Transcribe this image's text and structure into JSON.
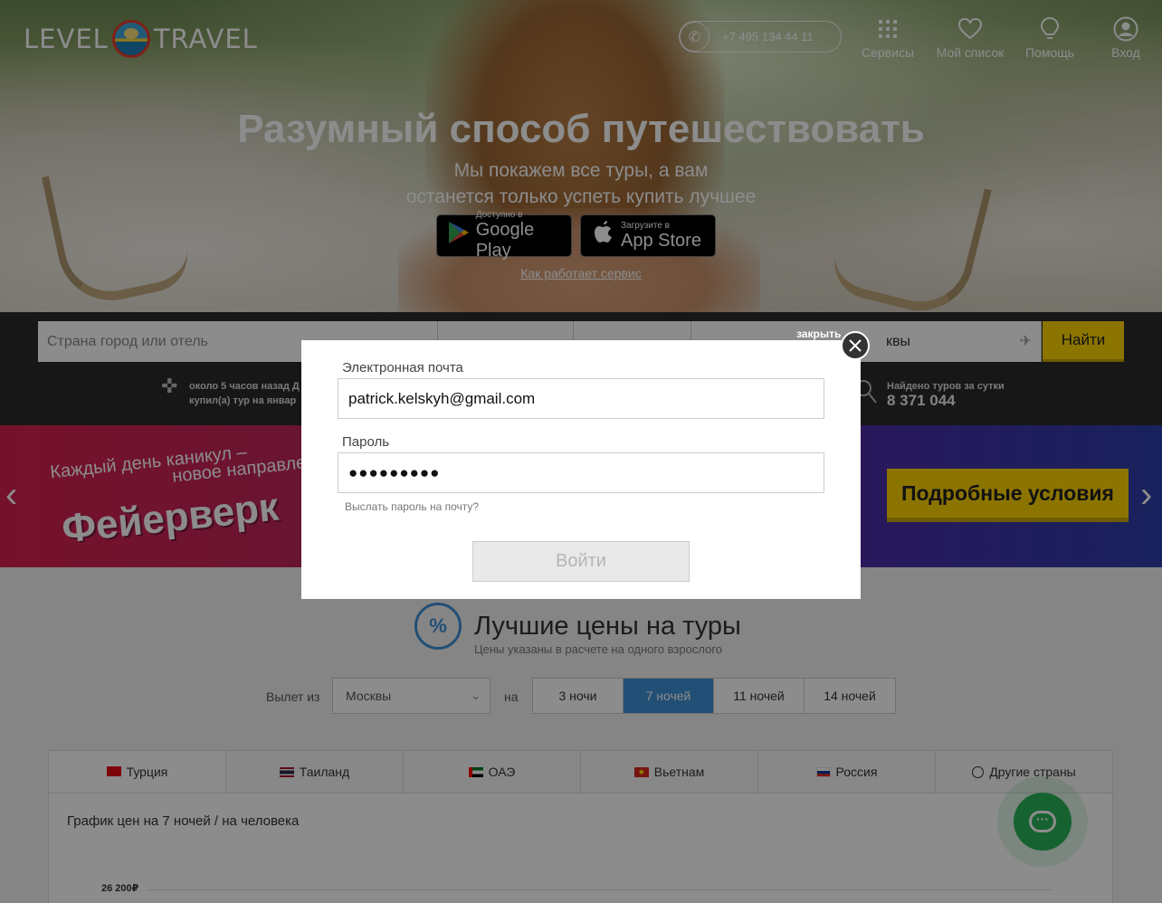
{
  "header": {
    "logo_left": "LEVEL",
    "logo_right": "TRAVEL",
    "phone": "+7 495 134 44 11",
    "nav": [
      {
        "label": "Сервисы",
        "icon": "grid-icon"
      },
      {
        "label": "Мой список",
        "icon": "heart-icon"
      },
      {
        "label": "Помощь",
        "icon": "help-bulb-icon"
      },
      {
        "label": "Вход",
        "icon": "user-icon"
      }
    ]
  },
  "hero": {
    "title": "Разумный способ путешествовать",
    "subtitle_line1": "Мы покажем все туры, а вам",
    "subtitle_line2": "останется только успеть купить лучшее",
    "google_small": "Доступно в",
    "google_big": "Google Play",
    "apple_small": "Загрузите в",
    "apple_big": "App Store",
    "how_link": "Как работает сервис"
  },
  "search": {
    "destination_placeholder": "Страна город или отель",
    "departure_value_tail": "квы",
    "find_label": "Найти",
    "recent_line1": "около 5 часов назад Д",
    "recent_line2": "купил(а) тур на январ",
    "found_label": "Найдено туров за сутки",
    "found_count": "8 371 044"
  },
  "banner": {
    "line1": "Каждый день каникул –",
    "line2": "новое направле",
    "firework": "Фейерверк",
    "details_label": "Подробные условия"
  },
  "best_prices": {
    "title": "Лучшие цены на туры",
    "subtitle": "Цены указаны в расчете на одного взрослого",
    "departure_label": "Вылет из",
    "departure_value": "Москвы",
    "on_label": "на",
    "nights": [
      "3 ночи",
      "7 ночей",
      "11 ночей",
      "14 ночей"
    ],
    "active_nights_index": 1,
    "tabs": [
      {
        "label": "Турция",
        "flag": "turkey-flag-icon"
      },
      {
        "label": "Таиланд",
        "flag": "thailand-flag-icon"
      },
      {
        "label": "ОАЭ",
        "flag": "uae-flag-icon"
      },
      {
        "label": "Вьетнам",
        "flag": "vietnam-flag-icon"
      },
      {
        "label": "Россия",
        "flag": "russia-flag-icon"
      },
      {
        "label": "Другие страны",
        "flag": "globe-icon"
      }
    ],
    "chart_title": "График цен на 7 ночей / на человека",
    "chart_y_label": "26 200₽"
  },
  "modal": {
    "close_label": "закрыть",
    "email_label": "Электронная почта",
    "email_value": "patrick.kelskyh@gmail.com",
    "password_label": "Пароль",
    "password_value": "●●●●●●●●●",
    "forgot_label": "Выслать пароль на почту?",
    "submit_label": "Войти"
  },
  "colors": {
    "accent_yellow": "#ffd300",
    "accent_blue": "#3e90d6",
    "chat_green": "#2ab25a"
  }
}
